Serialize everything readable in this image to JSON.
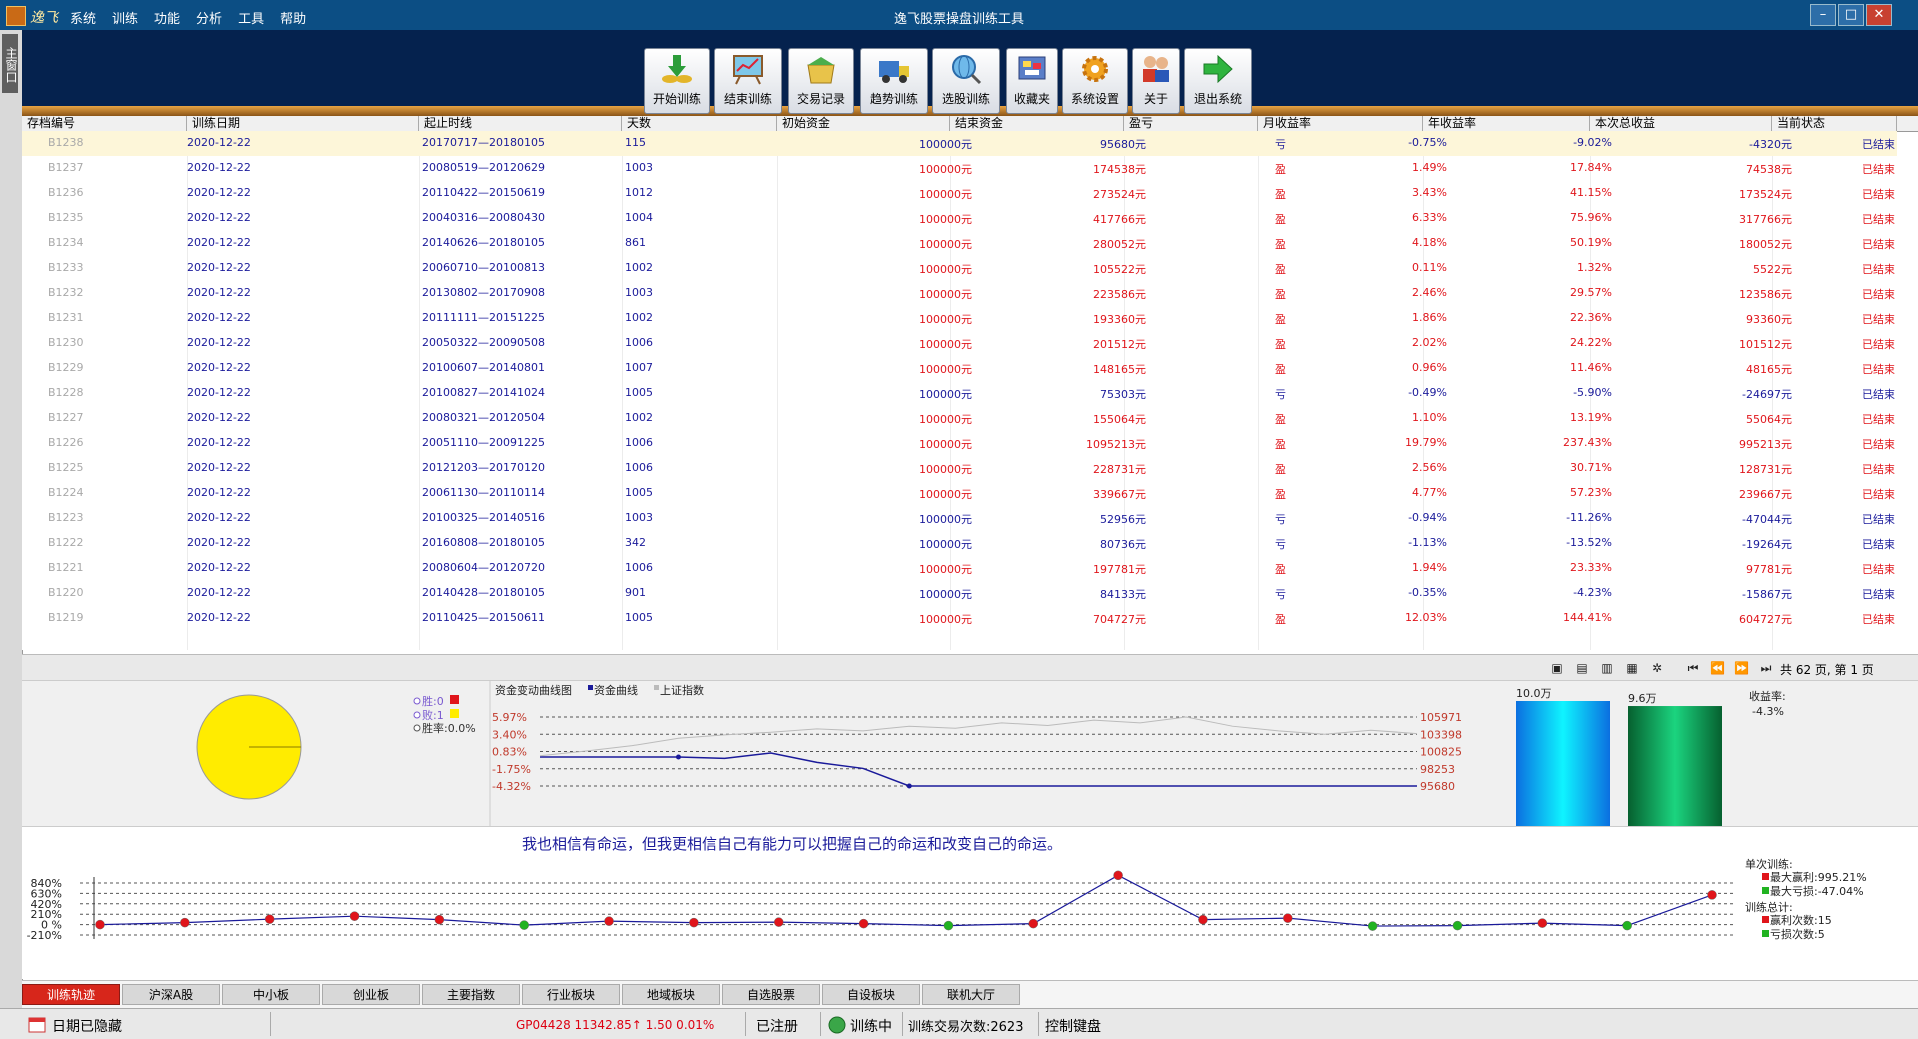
{
  "window": {
    "app_name": "逸飞",
    "title": "逸飞股票操盘训练工具",
    "menu": [
      "系统",
      "训练",
      "功能",
      "分析",
      "工具",
      "帮助"
    ]
  },
  "left_strip": {
    "tab_label": "主窗口"
  },
  "toolbar": {
    "buttons": [
      {
        "label": "开始训练",
        "icon": "coins-down-arrow-icon"
      },
      {
        "label": "结束训练",
        "icon": "easel-chart-icon"
      },
      {
        "label": "交易记录",
        "icon": "box-folder-icon"
      },
      {
        "label": "趋势训练",
        "icon": "truck-icon"
      },
      {
        "label": "选股训练",
        "icon": "globe-search-icon"
      },
      {
        "label": "收藏夹",
        "icon": "favorites-board-icon"
      },
      {
        "label": "系统设置",
        "icon": "gear-icon"
      },
      {
        "label": "关于",
        "icon": "people-icon"
      },
      {
        "label": "退出系统",
        "icon": "green-arrow-icon"
      }
    ]
  },
  "table": {
    "columns": [
      "存档编号",
      "训练日期",
      "起止时线",
      "天数",
      "初始资金",
      "结束资金",
      "盈亏",
      "月收益率",
      "年收益率",
      "本次总收益",
      "当前状态"
    ],
    "rows": [
      [
        "B1238",
        "2020-12-22",
        "20170717—20180105",
        "115",
        "100000元",
        "95680元",
        "亏",
        "-0.75%",
        "-9.02%",
        "-4320元",
        "已结束"
      ],
      [
        "B1237",
        "2020-12-22",
        "20080519—20120629",
        "1003",
        "100000元",
        "174538元",
        "盈",
        "1.49%",
        "17.84%",
        "74538元",
        "已结束"
      ],
      [
        "B1236",
        "2020-12-22",
        "20110422—20150619",
        "1012",
        "100000元",
        "273524元",
        "盈",
        "3.43%",
        "41.15%",
        "173524元",
        "已结束"
      ],
      [
        "B1235",
        "2020-12-22",
        "20040316—20080430",
        "1004",
        "100000元",
        "417766元",
        "盈",
        "6.33%",
        "75.96%",
        "317766元",
        "已结束"
      ],
      [
        "B1234",
        "2020-12-22",
        "20140626—20180105",
        "861",
        "100000元",
        "280052元",
        "盈",
        "4.18%",
        "50.19%",
        "180052元",
        "已结束"
      ],
      [
        "B1233",
        "2020-12-22",
        "20060710—20100813",
        "1002",
        "100000元",
        "105522元",
        "盈",
        "0.11%",
        "1.32%",
        "5522元",
        "已结束"
      ],
      [
        "B1232",
        "2020-12-22",
        "20130802—20170908",
        "1003",
        "100000元",
        "223586元",
        "盈",
        "2.46%",
        "29.57%",
        "123586元",
        "已结束"
      ],
      [
        "B1231",
        "2020-12-22",
        "20111111—20151225",
        "1002",
        "100000元",
        "193360元",
        "盈",
        "1.86%",
        "22.36%",
        "93360元",
        "已结束"
      ],
      [
        "B1230",
        "2020-12-22",
        "20050322—20090508",
        "1006",
        "100000元",
        "201512元",
        "盈",
        "2.02%",
        "24.22%",
        "101512元",
        "已结束"
      ],
      [
        "B1229",
        "2020-12-22",
        "20100607—20140801",
        "1007",
        "100000元",
        "148165元",
        "盈",
        "0.96%",
        "11.46%",
        "48165元",
        "已结束"
      ],
      [
        "B1228",
        "2020-12-22",
        "20100827—20141024",
        "1005",
        "100000元",
        "75303元",
        "亏",
        "-0.49%",
        "-5.90%",
        "-24697元",
        "已结束"
      ],
      [
        "B1227",
        "2020-12-22",
        "20080321—20120504",
        "1002",
        "100000元",
        "155064元",
        "盈",
        "1.10%",
        "13.19%",
        "55064元",
        "已结束"
      ],
      [
        "B1226",
        "2020-12-22",
        "20051110—20091225",
        "1006",
        "100000元",
        "1095213元",
        "盈",
        "19.79%",
        "237.43%",
        "995213元",
        "已结束"
      ],
      [
        "B1225",
        "2020-12-22",
        "20121203—20170120",
        "1006",
        "100000元",
        "228731元",
        "盈",
        "2.56%",
        "30.71%",
        "128731元",
        "已结束"
      ],
      [
        "B1224",
        "2020-12-22",
        "20061130—20110114",
        "1005",
        "100000元",
        "339667元",
        "盈",
        "4.77%",
        "57.23%",
        "239667元",
        "已结束"
      ],
      [
        "B1223",
        "2020-12-22",
        "20100325—20140516",
        "1003",
        "100000元",
        "52956元",
        "亏",
        "-0.94%",
        "-11.26%",
        "-47044元",
        "已结束"
      ],
      [
        "B1222",
        "2020-12-22",
        "20160808—20180105",
        "342",
        "100000元",
        "80736元",
        "亏",
        "-1.13%",
        "-13.52%",
        "-19264元",
        "已结束"
      ],
      [
        "B1221",
        "2020-12-22",
        "20080604—20120720",
        "1006",
        "100000元",
        "197781元",
        "盈",
        "1.94%",
        "23.33%",
        "97781元",
        "已结束"
      ],
      [
        "B1220",
        "2020-12-22",
        "20140428—20180105",
        "901",
        "100000元",
        "84133元",
        "亏",
        "-0.35%",
        "-4.23%",
        "-15867元",
        "已结束"
      ],
      [
        "B1219",
        "2020-12-22",
        "20110425—20150611",
        "1005",
        "100000元",
        "704727元",
        "盈",
        "12.03%",
        "144.41%",
        "604727元",
        "已结束"
      ]
    ]
  },
  "pager": {
    "text": "共 62 页, 第 1 页"
  },
  "stats": {
    "win_label": "胜:0",
    "loss_label": "败:1",
    "rate_label": "胜率:0.0%",
    "curve_title": "资金变动曲线图",
    "legend_fund": "资金曲线",
    "legend_index": "上证指数",
    "left_ticks": [
      "5.97%",
      "3.40%",
      "0.83%",
      "-1.75%",
      "-4.32%"
    ],
    "right_ticks": [
      "105971",
      "103398",
      "100825",
      "98253",
      "95680"
    ],
    "bar1_label": "10.0万",
    "bar2_label": "9.6万",
    "rate_title": "收益率:",
    "rate_value": "-4.3%"
  },
  "chart_data": [
    {
      "type": "pie",
      "labels": [
        "胜",
        "败"
      ],
      "values": [
        0,
        1
      ]
    },
    {
      "type": "line",
      "title": "资金变动曲线图",
      "series": [
        {
          "name": "资金曲线",
          "values": [
            100000,
            100000,
            100000,
            100000,
            99800,
            100600,
            99200,
            98300,
            95680,
            95680,
            95680,
            95680,
            95680,
            95680,
            95680,
            95680,
            95680,
            95680,
            95680,
            95680
          ]
        },
        {
          "name": "上证指数",
          "values": [
            100200,
            100900,
            101700,
            102800,
            103300,
            103700,
            104200,
            103900,
            104600,
            104300,
            105100,
            104700,
            105500,
            105100,
            105971,
            104600,
            103900,
            103400,
            104000,
            103500
          ]
        }
      ],
      "ylim": [
        95680,
        105971
      ]
    },
    {
      "type": "bar",
      "categories": [
        "初始资金",
        "结束资金"
      ],
      "values": [
        10.0,
        9.6
      ]
    },
    {
      "type": "line",
      "title": "",
      "y_ticks": [
        "840%",
        "630%",
        "420%",
        "210%",
        "0 %",
        "-210%"
      ],
      "series": [
        {
          "name": "",
          "values": [
            0,
            40,
            110,
            170,
            100,
            -10,
            70,
            40,
            50,
            20,
            -20,
            20,
            995,
            100,
            130,
            -30,
            -20,
            30,
            -20,
            600
          ]
        }
      ],
      "ylim": [
        -210,
        840
      ]
    }
  ],
  "motto": "我也相信有命运，但我更相信自己有能力可以把握自己的命运和改变自己的命运。",
  "summary": {
    "single_title": "单次训练:",
    "max_profit": "最大赢利:995.21%",
    "max_loss": "最大亏损:-47.04%",
    "total_title": "训练总计:",
    "profit_count": "赢利次数:15",
    "loss_count": "亏损次数:5"
  },
  "bottom_tabs": [
    "训练轨迹",
    "沪深A股",
    "中小板",
    "创业板",
    "主要指数",
    "行业板块",
    "地域板块",
    "自选股票",
    "自设板块",
    "联机大厅"
  ],
  "statusbar": {
    "date_hidden": "日期已隐藏",
    "quote": "GP04428 11342.85↑ 1.50 0.01%",
    "registered": "已注册",
    "training": "训练中",
    "trade_count": "训练交易次数:2623",
    "keyboard": "控制键盘"
  },
  "colors": {
    "profit": "#e0151b",
    "loss": "#1a1a9a",
    "toolbar_bg": "#05224e",
    "accent_tab": "#d7261b"
  }
}
